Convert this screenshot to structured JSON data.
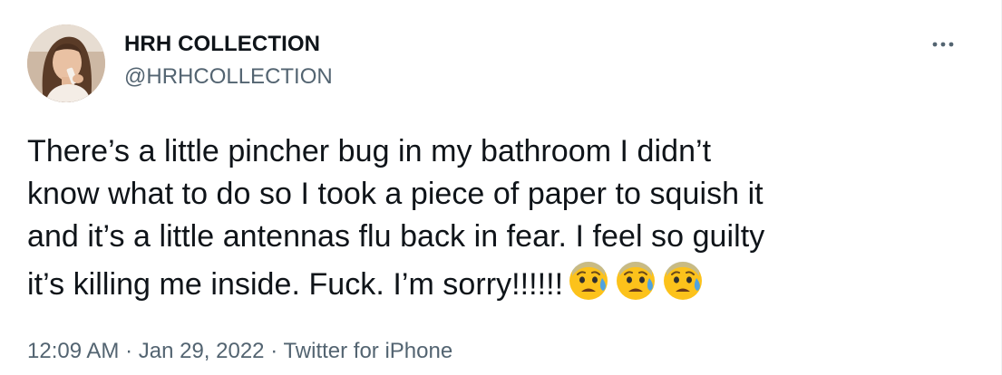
{
  "author": {
    "display_name": "HRH COLLECTION",
    "handle": "@HRHCOLLECTION"
  },
  "tweet": {
    "text": "There’s a little pincher bug in my bathroom I didn’t\nknow what to do so I took a piece of paper to squish it\nand it’s a little antennas flu back in fear. I feel so guilty\nit’s killing me inside. Fuck. I’m sorry!!!!!!",
    "emojis": [
      "anxious-face-with-sweat",
      "anxious-face-with-sweat",
      "anxious-face-with-sweat"
    ]
  },
  "meta": {
    "time": "12:09 AM",
    "separator": " · ",
    "date": "Jan 29, 2022",
    "source": "Twitter for iPhone"
  },
  "icons": {
    "more": "more-horizontal-icon"
  },
  "colors": {
    "text_primary": "#0f1419",
    "text_secondary": "#536471",
    "emoji_yellow": "#fcc21b",
    "emoji_blue": "#4fa3e0"
  }
}
